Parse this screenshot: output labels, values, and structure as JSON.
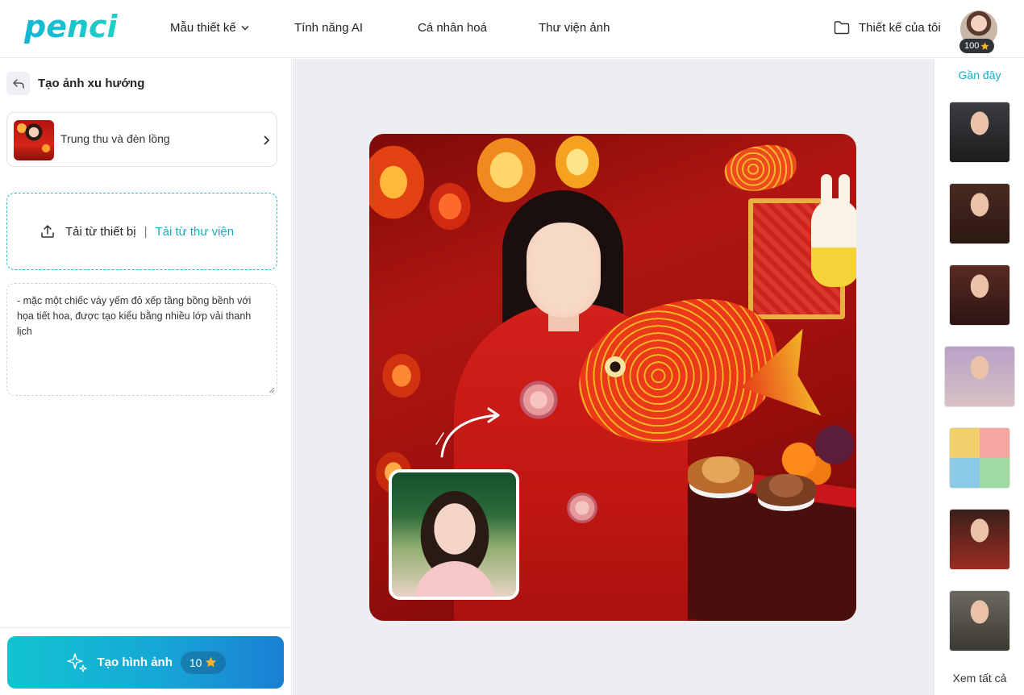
{
  "brand": {
    "logo_text": "penci",
    "accent_color": "#16b0c4"
  },
  "nav": {
    "items": [
      {
        "label": "Mẫu thiết kế",
        "has_dropdown": true
      },
      {
        "label": "Tính năng AI"
      },
      {
        "label": "Cá nhân hoá"
      },
      {
        "label": "Thư viện ảnh"
      }
    ],
    "my_designs_label": "Thiết kế của tôi",
    "credits": "100"
  },
  "left_panel": {
    "title": "Tạo ảnh xu hướng",
    "template_name": "Trung thu và đèn lồng",
    "upload_device_label": "Tải từ thiết bị",
    "upload_separator": "|",
    "upload_library_label": "Tải từ thư viện",
    "prompt_text": "- mặc một chiếc váy yếm đỏ xếp tầng bồng bềnh với họa tiết hoa, được tạo kiểu bằng nhiều lớp vải thanh lịch",
    "generate_label": "Tạo hình ảnh",
    "generate_cost": "10"
  },
  "right_rail": {
    "title": "Gần đây",
    "thumbnails": [
      {
        "name": "recent-thumb-1",
        "colors": [
          "#3b3d40",
          "#1c1c1e"
        ]
      },
      {
        "name": "recent-thumb-2",
        "colors": [
          "#4a2a22",
          "#2c1812"
        ]
      },
      {
        "name": "recent-thumb-3",
        "colors": [
          "#5b2a24",
          "#2a1512"
        ]
      },
      {
        "name": "recent-thumb-4",
        "colors": [
          "#b8a1c6",
          "#d9c1c4"
        ]
      },
      {
        "name": "recent-thumb-5",
        "colors": [
          "#f2d06b",
          "#8ccbe6"
        ]
      },
      {
        "name": "recent-thumb-6",
        "colors": [
          "#3a1f1a",
          "#9b2d22"
        ]
      },
      {
        "name": "recent-thumb-7",
        "colors": [
          "#6c6a60",
          "#3a3932"
        ]
      }
    ],
    "see_all_label": "Xem tất cả"
  }
}
